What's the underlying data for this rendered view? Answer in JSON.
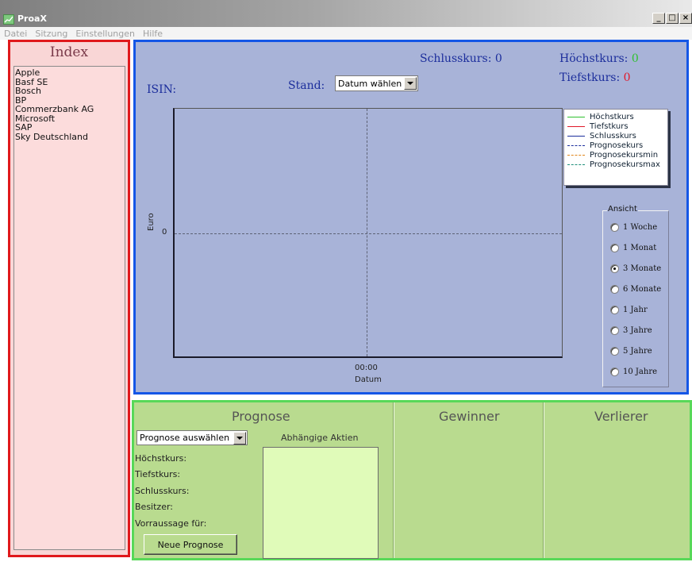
{
  "window": {
    "title": "ProaX",
    "buttons": {
      "minimize": "_",
      "maximize": "□",
      "close": "×"
    }
  },
  "menu": [
    "Datei",
    "Sitzung",
    "Einstellungen",
    "Hilfe"
  ],
  "index": {
    "title": "Index",
    "items": [
      "Apple",
      "Basf SE",
      "Bosch",
      "BP",
      "Commerzbank AG",
      "Microsoft",
      "SAP",
      "Sky Deutschland"
    ]
  },
  "chart_panel": {
    "isin_label": "ISIN:",
    "stand_label": "Stand:",
    "stand_value": "Datum wählen",
    "schlusskurs_label": "Schlusskurs:",
    "schlusskurs_value": "0",
    "hoechstkurs_label": "Höchstkurs:",
    "hoechstkurs_value": "0",
    "tiefstkurs_label": "Tiefstkurs:",
    "tiefstkurs_value": "0",
    "ansicht_label": "Ansicht",
    "ansicht_options": [
      "1 Woche",
      "1 Monat",
      "3 Monate",
      "6 Monate",
      "1 Jahr",
      "3 Jahre",
      "5 Jahre",
      "10 Jahre"
    ],
    "ansicht_selected": "3 Monate"
  },
  "chart_data": {
    "type": "line",
    "x": [
      "00:00"
    ],
    "xlabel": "Datum",
    "ylabel": "Euro",
    "yticks": [
      "0"
    ],
    "grid": false,
    "legend_position": "top-right",
    "series": [
      {
        "name": "Höchstkurs",
        "values": [],
        "color": "#2fc12f",
        "dash": "solid"
      },
      {
        "name": "Tiefstkurs",
        "values": [],
        "color": "#e0192a",
        "dash": "solid"
      },
      {
        "name": "Schlusskurs",
        "values": [],
        "color": "#1c2e9c",
        "dash": "solid"
      },
      {
        "name": "Prognosekurs",
        "values": [],
        "color": "#1c2e9c",
        "dash": "dashdot"
      },
      {
        "name": "Prognosekursmin",
        "values": [],
        "color": "#e0851a",
        "dash": "dashdot"
      },
      {
        "name": "Prognosekursmax",
        "values": [],
        "color": "#1f8f7a",
        "dash": "dashdot"
      }
    ]
  },
  "prognose": {
    "title": "Prognose",
    "select_value": "Prognose auswählen",
    "abhaengige_label": "Abhängige Aktien",
    "fields": [
      "Höchstkurs:",
      "Tiefstkurs:",
      "Schlusskurs:",
      "Besitzer:",
      "Vorraussage für:"
    ],
    "button_label": "Neue Prognose"
  },
  "gewinner": {
    "title": "Gewinner"
  },
  "verlierer": {
    "title": "Verlierer"
  }
}
